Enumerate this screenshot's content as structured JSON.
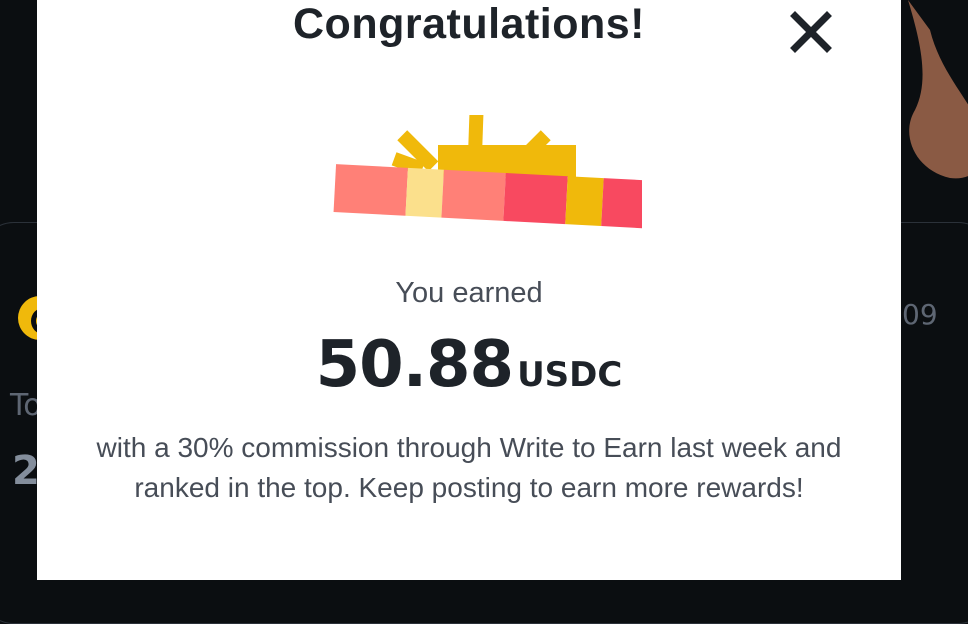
{
  "background": {
    "partial_label_left": "To",
    "partial_value_left": "2",
    "partial_value_right": "09"
  },
  "modal": {
    "title": "Congratulations!",
    "close_icon": "close-icon",
    "gift_icon": "gift-icon",
    "earned_label": "You earned",
    "amount": "50.88",
    "currency": "USDC",
    "description": "with a 30% commission through Write to Earn last week and ranked in the top. Keep posting to earn more rewards!"
  },
  "colors": {
    "modal_bg": "#ffffff",
    "title": "#1e2329",
    "body_text": "#474d57",
    "gift_red": "#f84960",
    "gift_pink": "#ff8077",
    "gift_yellow": "#f0b90b",
    "gift_light_yellow": "#fbe08c",
    "page_bg": "#0b0e11"
  }
}
